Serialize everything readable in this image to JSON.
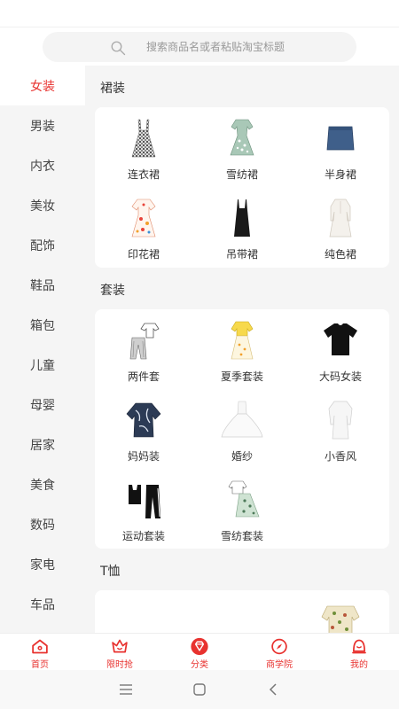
{
  "search": {
    "placeholder": "搜索商品名或者粘贴淘宝标题"
  },
  "sidebar": {
    "items": [
      {
        "label": "女装",
        "active": true
      },
      {
        "label": "男装"
      },
      {
        "label": "内衣"
      },
      {
        "label": "美妆"
      },
      {
        "label": "配饰"
      },
      {
        "label": "鞋品"
      },
      {
        "label": "箱包"
      },
      {
        "label": "儿童"
      },
      {
        "label": "母婴"
      },
      {
        "label": "居家"
      },
      {
        "label": "美食"
      },
      {
        "label": "数码"
      },
      {
        "label": "家电"
      },
      {
        "label": "车品"
      }
    ]
  },
  "sections": [
    {
      "title": "裙装",
      "items": [
        {
          "label": "连衣裙",
          "icon": "plaid-dress-icon"
        },
        {
          "label": "雪纺裙",
          "icon": "floral-dress-icon"
        },
        {
          "label": "半身裙",
          "icon": "denim-skirt-icon"
        },
        {
          "label": "印花裙",
          "icon": "print-dress-icon"
        },
        {
          "label": "吊带裙",
          "icon": "slip-dress-icon"
        },
        {
          "label": "纯色裙",
          "icon": "white-dress-icon"
        }
      ]
    },
    {
      "title": "套装",
      "items": [
        {
          "label": "两件套",
          "icon": "two-piece-icon"
        },
        {
          "label": "夏季套装",
          "icon": "summer-set-icon"
        },
        {
          "label": "大码女装",
          "icon": "black-tee-icon"
        },
        {
          "label": "妈妈装",
          "icon": "mom-wear-icon"
        },
        {
          "label": "婚纱",
          "icon": "wedding-dress-icon"
        },
        {
          "label": "小香风",
          "icon": "white-blouse-icon"
        },
        {
          "label": "运动套装",
          "icon": "sport-set-icon"
        },
        {
          "label": "雪纺套装",
          "icon": "chiffon-set-icon"
        }
      ]
    },
    {
      "title": "T恤",
      "items": []
    }
  ],
  "tabbar": {
    "items": [
      {
        "label": "首页",
        "icon": "home-icon"
      },
      {
        "label": "限时抢",
        "icon": "crown-icon"
      },
      {
        "label": "分类",
        "icon": "diamond-icon",
        "active": true
      },
      {
        "label": "商学院",
        "icon": "compass-icon"
      },
      {
        "label": "我的",
        "icon": "user-icon"
      }
    ]
  },
  "colors": {
    "accent": "#e8322f",
    "background": "#f5f5f5"
  }
}
